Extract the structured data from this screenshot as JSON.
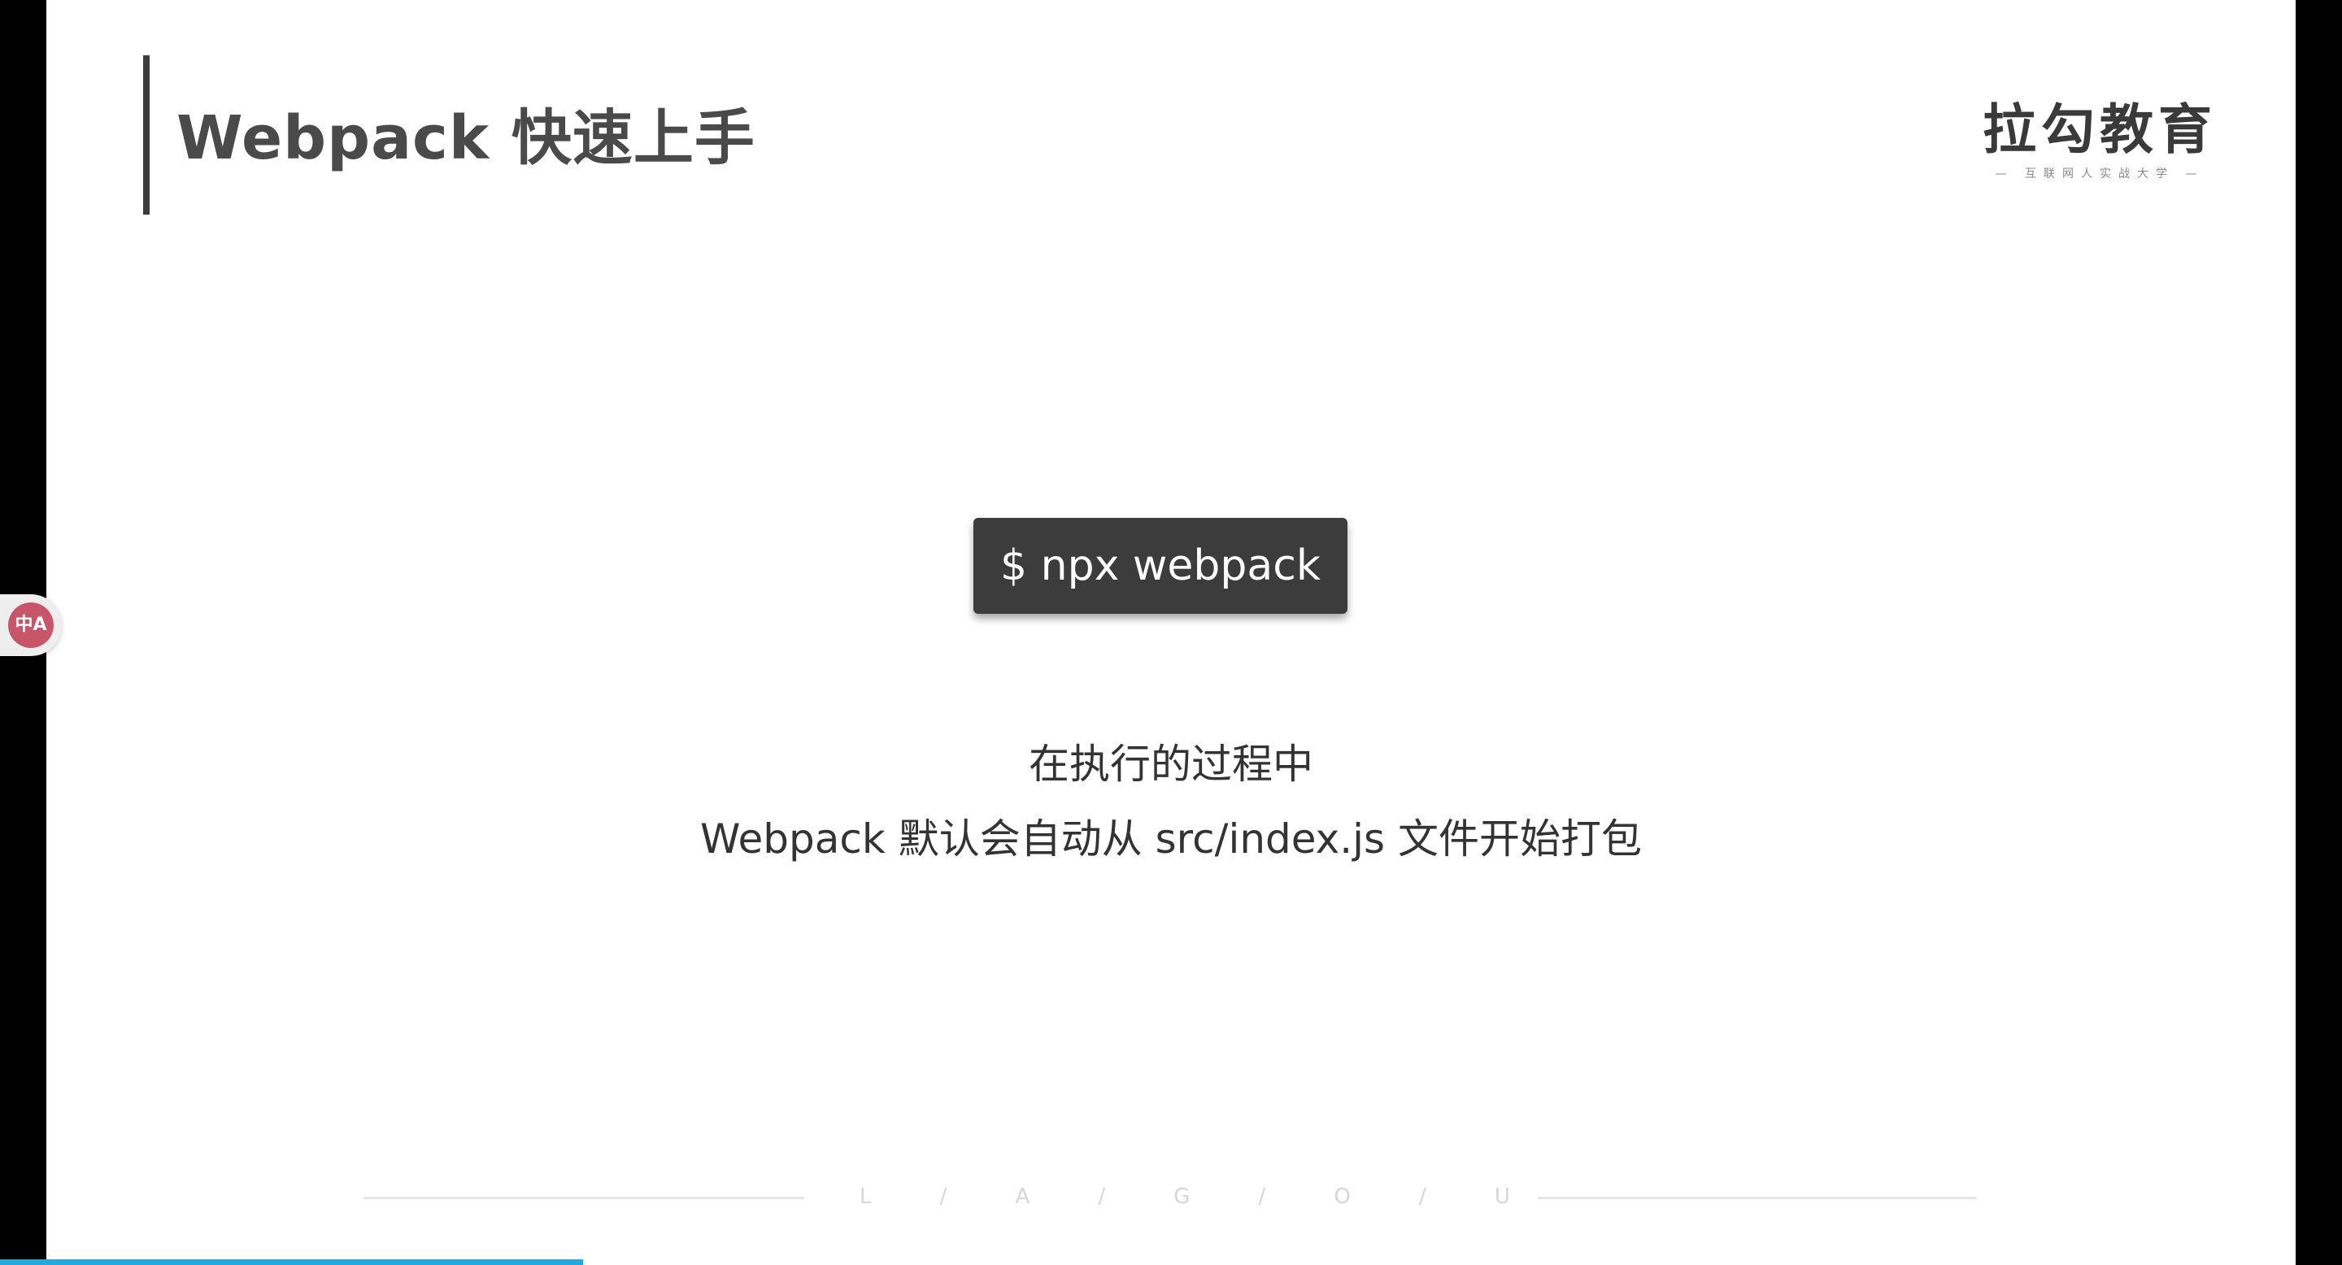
{
  "slide": {
    "title": "Webpack 快速上手",
    "logo": {
      "main": "拉勾教育",
      "sub": "— 互联网人实战大学 —"
    },
    "command": "$ npx webpack",
    "description": {
      "line1": "在执行的过程中",
      "line2": "Webpack 默认会自动从 src/index.js 文件开始打包"
    },
    "footer": {
      "letters": [
        "L",
        "/",
        "A",
        "/",
        "G",
        "/",
        "O",
        "/",
        "U"
      ]
    }
  },
  "overlay": {
    "translate_icon": "translate-icon",
    "translate_glyph": "中A"
  },
  "playback": {
    "progress_fraction": 0.249
  },
  "colors": {
    "accent_progress": "#23a9e0",
    "command_bg": "#3c3c3c",
    "title_text": "#4a4a4a",
    "translate_icon_bg": "#c8566a"
  }
}
